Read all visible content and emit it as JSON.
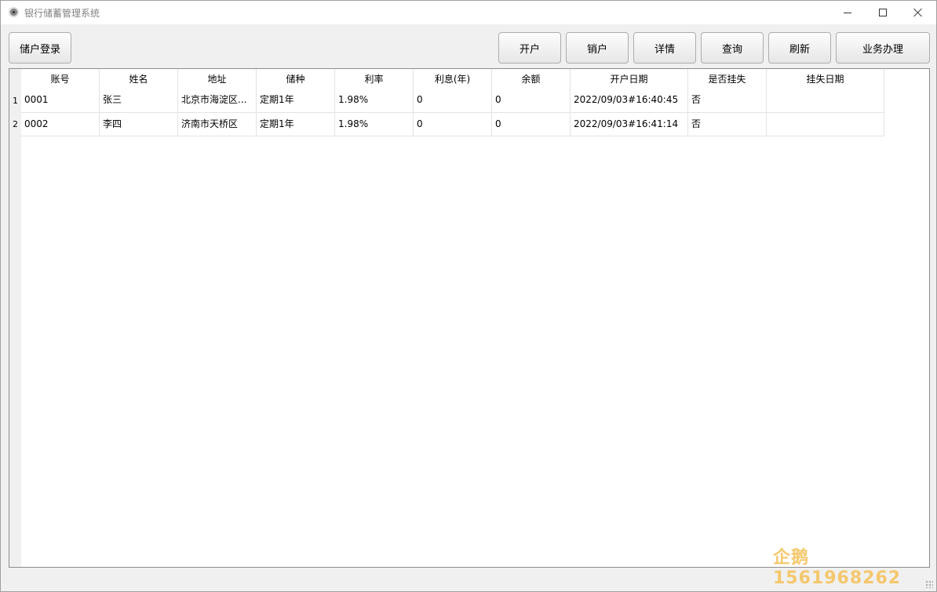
{
  "window": {
    "title": "银行储蓄管理系统"
  },
  "toolbar": {
    "login_label": "储户登录",
    "open_label": "开户",
    "close_label": "销户",
    "detail_label": "详情",
    "query_label": "查询",
    "refresh_label": "刷新",
    "business_label": "业务办理"
  },
  "table": {
    "columns": [
      "账号",
      "姓名",
      "地址",
      "储种",
      "利率",
      "利息(年)",
      "余额",
      "开户日期",
      "是否挂失",
      "挂失日期"
    ],
    "rows": [
      {
        "num": "1",
        "cells": [
          "0001",
          "张三",
          "北京市海淀区...",
          "定期1年",
          "1.98%",
          "0",
          "0",
          "2022/09/03#16:40:45",
          "否",
          ""
        ]
      },
      {
        "num": "2",
        "cells": [
          "0002",
          "李四",
          "济南市天桥区",
          "定期1年",
          "1.98%",
          "0",
          "0",
          "2022/09/03#16:41:14",
          "否",
          ""
        ]
      }
    ]
  },
  "watermark": {
    "text": "企鹅 1561968262"
  },
  "icons": {
    "app": "app-icon",
    "minimize": "minimize-icon",
    "maximize": "maximize-icon",
    "close": "close-icon"
  },
  "colors": {
    "background": "#f0f0f0",
    "watermark": "#f6c35e"
  }
}
